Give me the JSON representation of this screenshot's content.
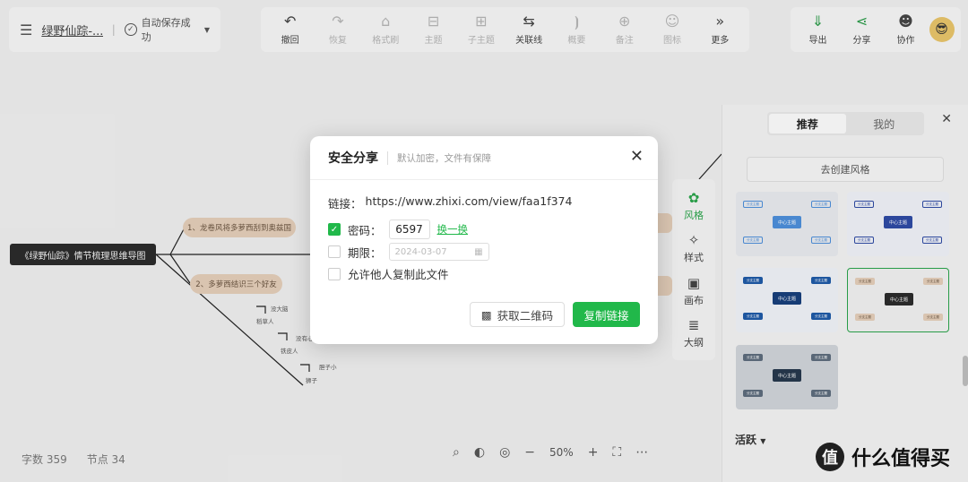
{
  "header": {
    "doc_title": "绿野仙踪-...",
    "separator": "|",
    "save_status": "自动保存成功"
  },
  "toolbar": {
    "items": [
      {
        "label": "撤回",
        "icon": "undo-icon",
        "glyph": "↶",
        "enabled": true
      },
      {
        "label": "恢复",
        "icon": "redo-icon",
        "glyph": "↷",
        "enabled": false
      },
      {
        "label": "格式刷",
        "icon": "format-brush-icon",
        "glyph": "⌂",
        "enabled": false
      },
      {
        "label": "主题",
        "icon": "topic-icon",
        "glyph": "⊟",
        "enabled": false
      },
      {
        "label": "子主题",
        "icon": "subtopic-icon",
        "glyph": "⊞",
        "enabled": false
      },
      {
        "label": "关联线",
        "icon": "relation-line-icon",
        "glyph": "⇆",
        "enabled": true
      },
      {
        "label": "概要",
        "icon": "summary-icon",
        "glyph": "⦘",
        "enabled": false
      },
      {
        "label": "备注",
        "icon": "note-icon",
        "glyph": "⊕",
        "enabled": false
      },
      {
        "label": "图标",
        "icon": "emoji-icon",
        "glyph": "☺",
        "enabled": false
      },
      {
        "label": "更多",
        "icon": "more-icon",
        "glyph": "»",
        "enabled": true
      }
    ],
    "right": [
      {
        "label": "导出",
        "icon": "export-icon",
        "glyph": "⇓"
      },
      {
        "label": "分享",
        "icon": "share-icon",
        "glyph": "⋖"
      },
      {
        "label": "协作",
        "icon": "collaborate-icon",
        "glyph": "☻"
      }
    ]
  },
  "mindmap": {
    "root": "《绿野仙踪》情节梳理思维导图",
    "branch1": "1、龙卷风将多萝西刮到奥兹国",
    "branch2": "2、多萝西结识三个好友",
    "leaves": [
      "没大脑",
      "稻草人",
      "没有心",
      "铁皮人",
      "胆子小",
      "狮子"
    ]
  },
  "side_tools": [
    {
      "label": "风格",
      "icon": "palette-icon",
      "glyph": "✿",
      "active": true
    },
    {
      "label": "样式",
      "icon": "style-icon",
      "glyph": "✧",
      "active": false
    },
    {
      "label": "画布",
      "icon": "canvas-icon",
      "glyph": "▣",
      "active": false
    },
    {
      "label": "大纲",
      "icon": "outline-icon",
      "glyph": "≣",
      "active": false
    }
  ],
  "panel": {
    "tabs": [
      "推荐",
      "我的"
    ],
    "create_style": "去创建风格",
    "center_label": "中心主题",
    "topic_label": "分支主题",
    "section_label": "活跃"
  },
  "share_modal": {
    "title": "安全分享",
    "subtitle": "默认加密，文件有保障",
    "link_label": "链接：",
    "link_url": "https://www.zhixi.com/view/faa1f374",
    "password_label": "密码：",
    "password_value": "6597",
    "swap_label": "换一换",
    "expire_label": "期限：",
    "expire_placeholder": "2024-03-07",
    "allow_copy_label": "允许他人复制此文件",
    "qr_button": "获取二维码",
    "copy_button": "复制链接"
  },
  "footer": {
    "word_count": "字数 359",
    "node_count": "节点 34",
    "zoom": "50%"
  },
  "watermark": {
    "logo": "值",
    "text": "什么值得买"
  },
  "colors": {
    "accent": "#21b84a",
    "root_bg": "#2b2b2b",
    "branch_bg": "#e2cdb8"
  }
}
